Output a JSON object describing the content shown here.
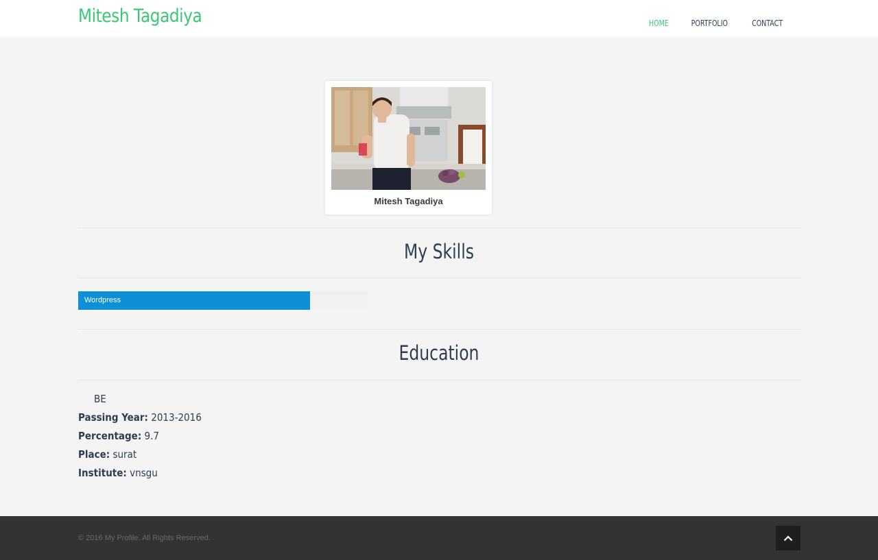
{
  "header": {
    "brand": "Mitesh Tagadiya",
    "nav": [
      "HOME",
      "PORTFOLIO",
      "CONTACT"
    ],
    "active_nav": "HOME"
  },
  "profile": {
    "name": "Mitesh Tagadiya"
  },
  "skills": {
    "title": "My Skills",
    "items": [
      {
        "label": "Wordpress",
        "level_percent": 80
      }
    ]
  },
  "education": {
    "title": "Education",
    "degree": "BE",
    "fields": [
      {
        "label": "Passing Year:",
        "value": "2013-2016"
      },
      {
        "label": "Percentage:",
        "value": "9.7"
      },
      {
        "label": "Place:",
        "value": "surat"
      },
      {
        "label": "Institute:",
        "value": "vnsgu"
      }
    ]
  },
  "footer": {
    "copyright": "© 2016 My Profile. All Rights Reserved."
  },
  "colors": {
    "accent": "#3cc773",
    "skill_bar": "#0f8fd6",
    "footer_bg": "#333333"
  },
  "icons": {
    "to_top": "chevron-up-icon"
  }
}
